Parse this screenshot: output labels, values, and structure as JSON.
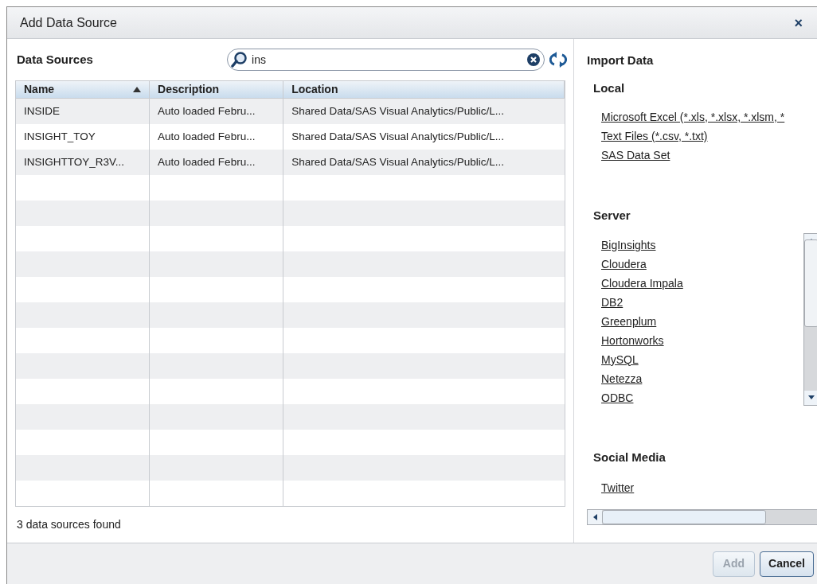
{
  "window": {
    "title": "Add Data Source",
    "close": "×"
  },
  "data_sources": {
    "heading": "Data Sources",
    "search": {
      "value": "ins"
    },
    "table": {
      "columns": [
        {
          "label": "Name",
          "sorted": true
        },
        {
          "label": "Description",
          "sorted": false
        },
        {
          "label": "Location",
          "sorted": false
        }
      ],
      "rows": [
        [
          "INSIDE",
          "Auto loaded Febru...",
          "Shared Data/SAS Visual Analytics/Public/L..."
        ],
        [
          "INSIGHT_TOY",
          "Auto loaded Febru...",
          "Shared Data/SAS Visual Analytics/Public/L..."
        ],
        [
          "INSIGHTTOY_R3V...",
          "Auto loaded Febru...",
          "Shared Data/SAS Visual Analytics/Public/L..."
        ]
      ]
    },
    "status": "3 data sources found"
  },
  "import_data": {
    "heading": "Import Data",
    "local": {
      "heading": "Local",
      "items": [
        "Microsoft Excel (*.xls, *.xlsx, *.xlsm, *",
        "Text Files (*.csv, *.txt)",
        "SAS Data Set"
      ]
    },
    "server": {
      "heading": "Server",
      "items": [
        "BigInsights",
        "Cloudera",
        "Cloudera Impala",
        "DB2",
        "Greenplum",
        "Hortonworks",
        "MySQL",
        "Netezza",
        "ODBC"
      ]
    },
    "social_media": {
      "heading": "Social Media",
      "items": [
        "Twitter"
      ]
    }
  },
  "buttons": [
    {
      "label": "Add",
      "disabled": true
    },
    {
      "label": "Cancel",
      "disabled": false
    }
  ]
}
